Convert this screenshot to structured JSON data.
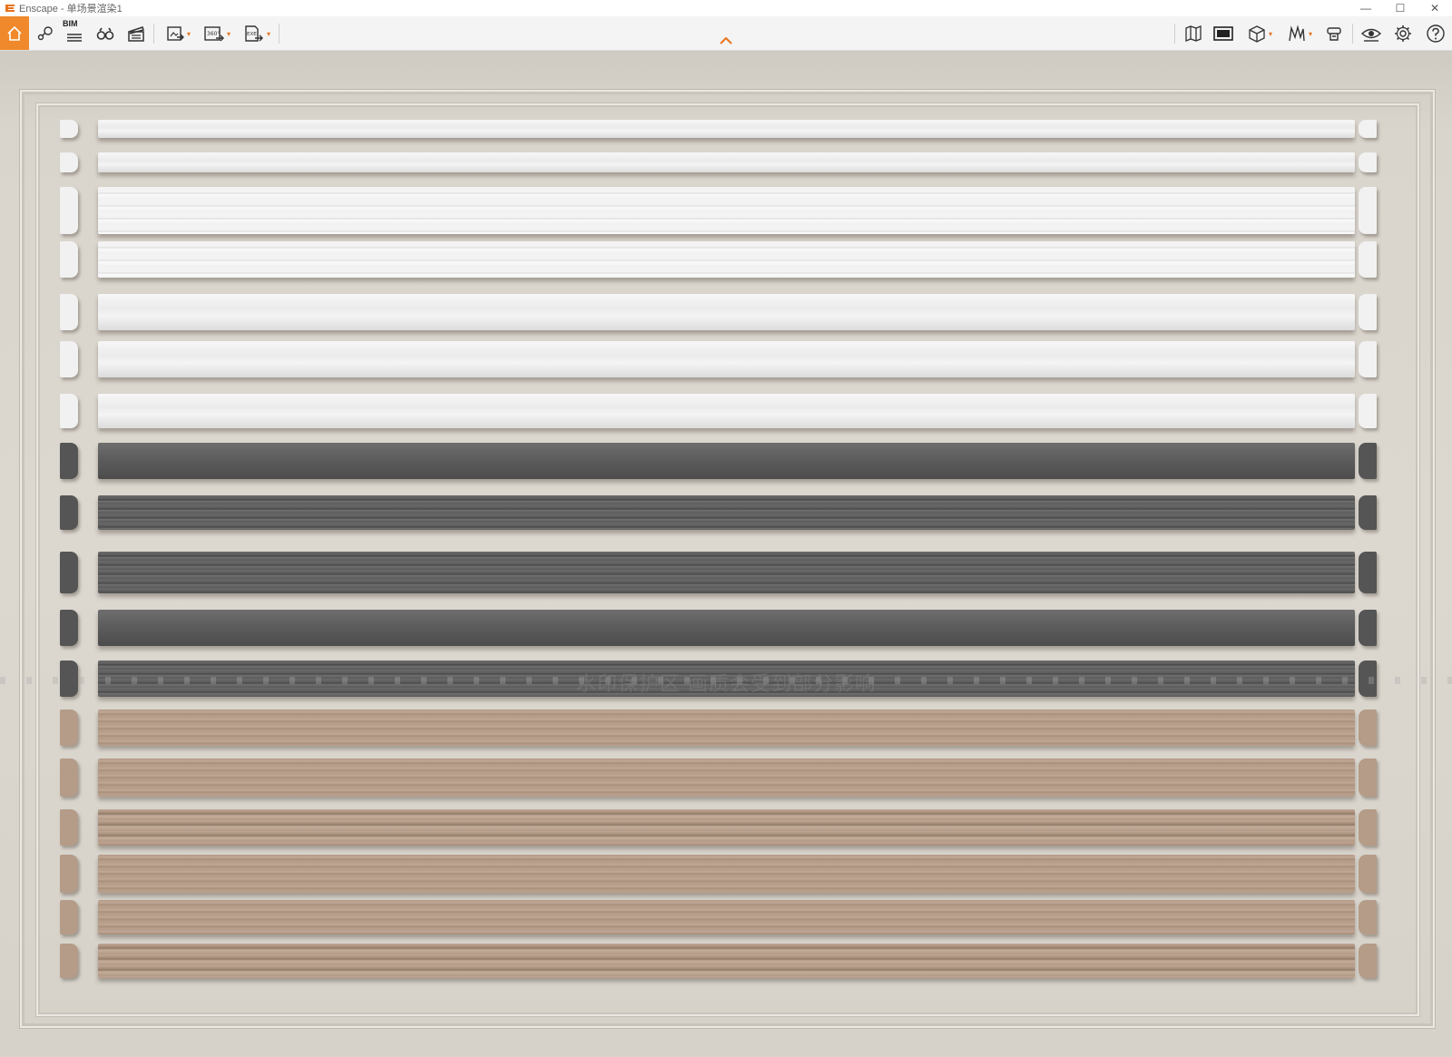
{
  "window": {
    "app_name": "Enscape",
    "title": "Enscape - 单场景渲染1",
    "controls": [
      "—",
      "☐",
      "✕"
    ]
  },
  "toolbar": {
    "bim_label": "BIM",
    "collapse_icon": "chevron-up-icon",
    "left_tools": [
      "home-icon",
      "camera-path-icon",
      "bim-icon",
      "binoculars-icon",
      "clapper-icon",
      "screenshot-export-icon",
      "panorama-360-export-icon",
      "exe-export-icon"
    ],
    "right_tools": [
      "map-icon",
      "image-view-icon",
      "cube-icon",
      "asset-library-icon",
      "material-editor-icon",
      "visibility-icon",
      "settings-gear-icon",
      "help-icon"
    ],
    "export_360_label": "360°",
    "export_exe_label": "EXE"
  },
  "viewport": {
    "watermark_text": "水印保护区  画质会受到部分影响",
    "brand_mark": "知末",
    "moldings": [
      {
        "color": "white",
        "style": "flat"
      },
      {
        "color": "white",
        "style": "flat"
      },
      {
        "color": "white",
        "style": "ribbed"
      },
      {
        "color": "white",
        "style": "ribbed"
      },
      {
        "color": "white",
        "style": "flat"
      },
      {
        "color": "white",
        "style": "flat"
      },
      {
        "color": "white",
        "style": "flat"
      },
      {
        "color": "grey",
        "style": "flat"
      },
      {
        "color": "grey",
        "style": "ribbed"
      },
      {
        "color": "grey",
        "style": "ribbed"
      },
      {
        "color": "grey",
        "style": "flat"
      },
      {
        "color": "grey",
        "style": "ribbed"
      },
      {
        "color": "wood",
        "style": "flat"
      },
      {
        "color": "wood",
        "style": "flat"
      },
      {
        "color": "wood",
        "style": "ribbed"
      },
      {
        "color": "wood",
        "style": "flat"
      },
      {
        "color": "wood",
        "style": "flat"
      },
      {
        "color": "wood",
        "style": "ribbed"
      }
    ]
  },
  "colors": {
    "accent": "#f0892b",
    "wall": "#dcd8d0",
    "white_molding": "#f1f1f1",
    "grey_molding": "#5b5b5b",
    "wood_molding": "#b8a08c"
  }
}
